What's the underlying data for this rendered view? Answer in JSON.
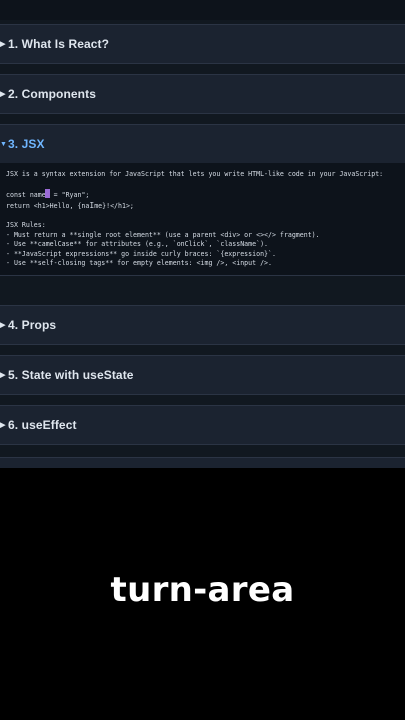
{
  "accordion": {
    "items": [
      {
        "label": "1. What Is React?"
      },
      {
        "label": "2. Components"
      },
      {
        "label": "3. JSX"
      },
      {
        "label": "4. Props"
      },
      {
        "label": "5. State with useState"
      },
      {
        "label": "6. useEffect"
      }
    ],
    "open_content": {
      "line1": "JSX is a syntax extension for JavaScript that lets you write HTML-like code in your JavaScript:",
      "code1_a": "const name",
      "code1_b": " = \"Ryan\";",
      "code2_a": "return <h1>Hello, {na",
      "code2_b": "me}!</h1>;",
      "rules_title": "JSX Rules:",
      "rule1": "- Must return a **single root element** (use a parent <div> or <></> fragment).",
      "rule2": "- Use **camelCase** for attributes (e.g., `onClick`, `className`).",
      "rule3": "- **JavaScript expressions** go inside curly braces: `{expression}`.",
      "rule4": "- Use **self-closing tags** for empty elements: <img />, <input />."
    }
  },
  "caption": "turn-area",
  "colors": {
    "accent": "#6fb6ff",
    "panel": "#1b2330",
    "content_bg": "#0d131b"
  }
}
